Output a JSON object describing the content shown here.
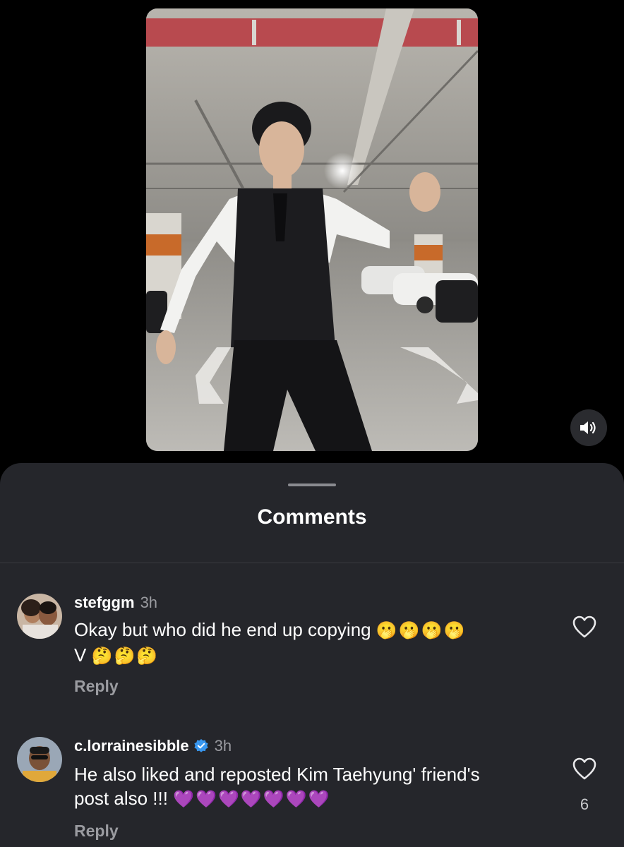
{
  "video": {
    "mute_icon": "speaker-icon"
  },
  "comments_sheet": {
    "title": "Comments",
    "comments": [
      {
        "username": "stefggm",
        "time": "3h",
        "verified": false,
        "text": "Okay but who did he end up copying",
        "emoji_line1": "🫢🫢🫢🫢",
        "text_line2": "V",
        "emoji_line2": "🤔🤔🤔",
        "reply_label": "Reply",
        "like_icon": "heart-outline-icon",
        "like_count": ""
      },
      {
        "username": "c.lorrainesibble",
        "time": "3h",
        "verified": true,
        "text": "He also liked and reposted Kim Taehyung' friend's",
        "text_line2": "post also !!!",
        "emoji_line2": "💜💜💜💜💜💜💜",
        "reply_label": "Reply",
        "like_icon": "heart-outline-icon",
        "like_count": "6"
      }
    ]
  },
  "colors": {
    "sheet_bg": "#25262b",
    "page_bg": "#000000",
    "verified_badge": "#3897f0",
    "muted_text": "#9a9ba0"
  }
}
